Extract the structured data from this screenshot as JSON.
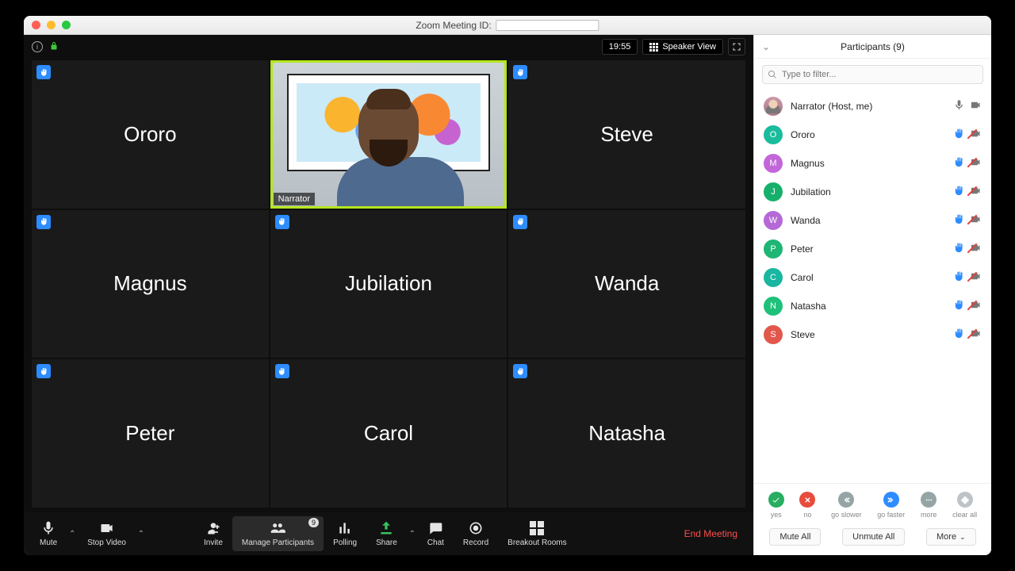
{
  "window": {
    "title": "Zoom Meeting ID:"
  },
  "topbar": {
    "time": "19:55",
    "view_label": "Speaker View"
  },
  "tiles": [
    {
      "name": "Ororo",
      "hand": true,
      "active": false
    },
    {
      "name": "Narrator",
      "hand": false,
      "active": true,
      "tag": "Narrator"
    },
    {
      "name": "Steve",
      "hand": true,
      "active": false
    },
    {
      "name": "Magnus",
      "hand": true,
      "active": false
    },
    {
      "name": "Jubilation",
      "hand": true,
      "active": false
    },
    {
      "name": "Wanda",
      "hand": true,
      "active": false
    },
    {
      "name": "Peter",
      "hand": true,
      "active": false
    },
    {
      "name": "Carol",
      "hand": true,
      "active": false
    },
    {
      "name": "Natasha",
      "hand": true,
      "active": false
    }
  ],
  "toolbar": {
    "mute": "Mute",
    "stop_video": "Stop Video",
    "invite": "Invite",
    "manage": "Manage Participants",
    "manage_badge": "9",
    "polling": "Polling",
    "share": "Share",
    "chat": "Chat",
    "record": "Record",
    "breakout": "Breakout Rooms",
    "end": "End Meeting"
  },
  "panel": {
    "title": "Participants (9)",
    "search_placeholder": "Type to filter...",
    "reactions": {
      "yes": "yes",
      "no": "no",
      "slower": "go slower",
      "faster": "go faster",
      "more": "more",
      "clear": "clear all"
    },
    "buttons": {
      "mute_all": "Mute All",
      "unmute_all": "Unmute All",
      "more": "More"
    }
  },
  "participants": [
    {
      "name": "Narrator (Host, me)",
      "initial": "",
      "color": "img",
      "hand": false,
      "mic": "on",
      "cam": "on"
    },
    {
      "name": "Ororo",
      "initial": "O",
      "color": "#1abc9c",
      "hand": true,
      "mic": "off",
      "cam": "off"
    },
    {
      "name": "Magnus",
      "initial": "M",
      "color": "#c266d9",
      "hand": true,
      "mic": "off",
      "cam": "off"
    },
    {
      "name": "Jubilation",
      "initial": "J",
      "color": "#17b06b",
      "hand": true,
      "mic": "off",
      "cam": "off"
    },
    {
      "name": "Wanda",
      "initial": "W",
      "color": "#b569d6",
      "hand": true,
      "mic": "off",
      "cam": "off"
    },
    {
      "name": "Peter",
      "initial": "P",
      "color": "#1fb574",
      "hand": true,
      "mic": "off",
      "cam": "off"
    },
    {
      "name": "Carol",
      "initial": "C",
      "color": "#19b6a0",
      "hand": true,
      "mic": "off",
      "cam": "off"
    },
    {
      "name": "Natasha",
      "initial": "N",
      "color": "#1ec07a",
      "hand": true,
      "mic": "off",
      "cam": "off"
    },
    {
      "name": "Steve",
      "initial": "S",
      "color": "#e2574c",
      "hand": true,
      "mic": "off",
      "cam": "off"
    }
  ]
}
